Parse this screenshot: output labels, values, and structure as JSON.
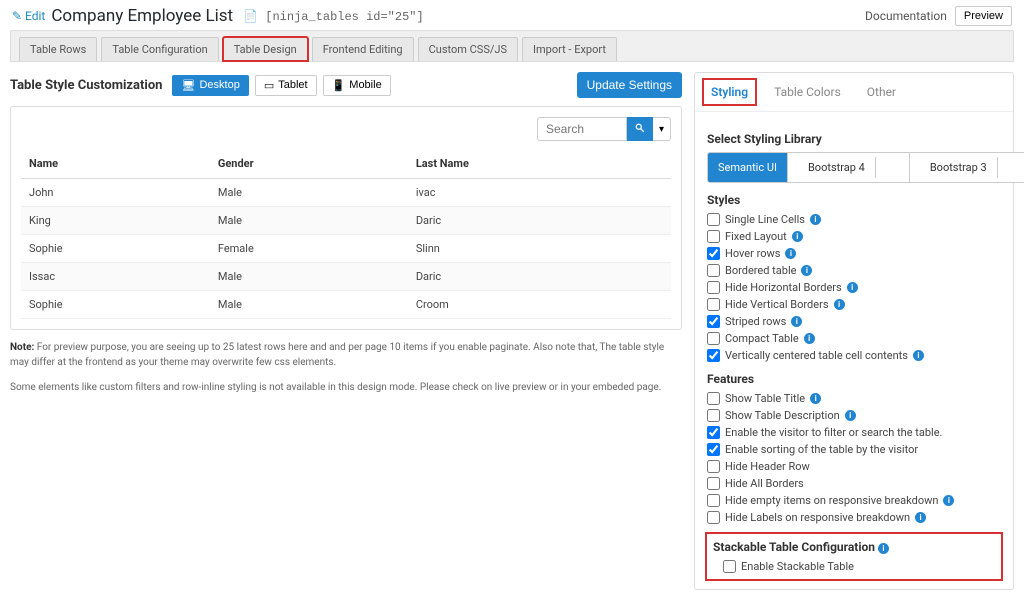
{
  "header": {
    "edit": "Edit",
    "title": "Company Employee List",
    "shortcode": "[ninja_tables id=\"25\"]",
    "doc": "Documentation",
    "preview": "Preview"
  },
  "tabs": [
    "Table Rows",
    "Table Configuration",
    "Table Design",
    "Frontend Editing",
    "Custom CSS/JS",
    "Import - Export"
  ],
  "section_title": "Table Style Customization",
  "devices": {
    "desktop": "Desktop",
    "tablet": "Tablet",
    "mobile": "Mobile"
  },
  "update_btn": "Update Settings",
  "search_placeholder": "Search",
  "table": {
    "headers": [
      "Name",
      "Gender",
      "Last Name"
    ],
    "rows": [
      [
        "John",
        "Male",
        "ivac"
      ],
      [
        "King",
        "Male",
        "Daric"
      ],
      [
        "Sophie",
        "Female",
        "Slinn"
      ],
      [
        "Issac",
        "Male",
        "Daric"
      ],
      [
        "Sophie",
        "Male",
        "Croom"
      ]
    ]
  },
  "note1_label": "Note:",
  "note1": " For preview purpose, you are seeing up to 25 latest rows here and and per page 10 items if you enable paginate. Also note that, The table style may differ at the frontend as your theme may overwrite few css elements.",
  "note2": "Some elements like custom filters and row-inline styling is not available in this design mode. Please check on live preview or in your embeded page.",
  "side": {
    "tabs": {
      "styling": "Styling",
      "colors": "Table Colors",
      "other": "Other"
    },
    "select_lib": "Select Styling Library",
    "libs": [
      "Semantic UI",
      "Bootstrap 4",
      "Bootstrap 3"
    ],
    "styles_label": "Styles",
    "styles": [
      {
        "label": "Single Line Cells",
        "checked": false,
        "info": true
      },
      {
        "label": "Fixed Layout",
        "checked": false,
        "info": true
      },
      {
        "label": "Hover rows",
        "checked": true,
        "info": true
      },
      {
        "label": "Bordered table",
        "checked": false,
        "info": true
      },
      {
        "label": "Hide Horizontal Borders",
        "checked": false,
        "info": true
      },
      {
        "label": "Hide Vertical Borders",
        "checked": false,
        "info": true
      },
      {
        "label": "Striped rows",
        "checked": true,
        "info": true
      },
      {
        "label": "Compact Table",
        "checked": false,
        "info": true
      },
      {
        "label": "Vertically centered table cell contents",
        "checked": true,
        "info": true
      }
    ],
    "features_label": "Features",
    "features": [
      {
        "label": "Show Table Title",
        "checked": false,
        "info": true
      },
      {
        "label": "Show Table Description",
        "checked": false,
        "info": true
      },
      {
        "label": "Enable the visitor to filter or search the table.",
        "checked": true,
        "info": false
      },
      {
        "label": "Enable sorting of the table by the visitor",
        "checked": true,
        "info": false
      },
      {
        "label": "Hide Header Row",
        "checked": false,
        "info": false
      },
      {
        "label": "Hide All Borders",
        "checked": false,
        "info": false
      },
      {
        "label": "Hide empty items on responsive breakdown",
        "checked": false,
        "info": true
      },
      {
        "label": "Hide Labels on responsive breakdown",
        "checked": false,
        "info": true
      }
    ],
    "stack": {
      "title": "Stackable Table Configuration",
      "label": "Enable Stackable Table"
    }
  }
}
